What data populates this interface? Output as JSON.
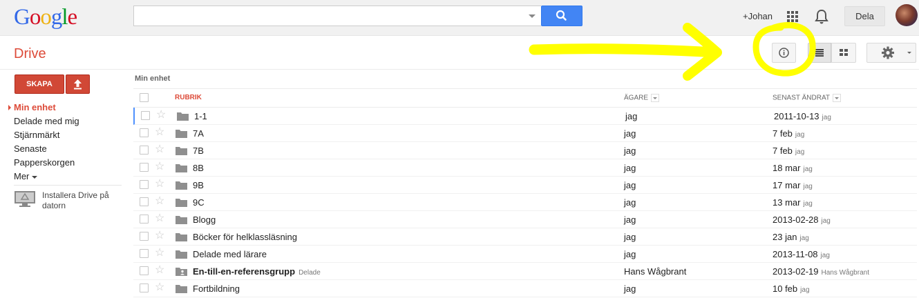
{
  "header": {
    "logo": "Google",
    "search_placeholder": "",
    "user_name": "+Johan",
    "share_label": "Dela"
  },
  "app": {
    "title": "Drive",
    "create_label": "SKAPA"
  },
  "sidebar": {
    "items": [
      {
        "label": "Min enhet",
        "active": true
      },
      {
        "label": "Delade med mig"
      },
      {
        "label": "Stjärnmärkt"
      },
      {
        "label": "Senaste"
      },
      {
        "label": "Papperskorgen"
      },
      {
        "label": "Mer"
      }
    ],
    "install_label": "Installera Drive på datorn"
  },
  "breadcrumb": "Min enhet",
  "table": {
    "columns": {
      "title": "RUBRIK",
      "owner": "ÄGARE",
      "modified": "SENAST ÄNDRAT"
    },
    "rows": [
      {
        "name": "1-1",
        "owner": "jag",
        "date": "2011-10-13",
        "by": "jag"
      },
      {
        "name": "7A",
        "owner": "jag",
        "date": "7 feb",
        "by": "jag"
      },
      {
        "name": "7B",
        "owner": "jag",
        "date": "7 feb",
        "by": "jag"
      },
      {
        "name": "8B",
        "owner": "jag",
        "date": "18 mar",
        "by": "jag"
      },
      {
        "name": "9B",
        "owner": "jag",
        "date": "17 mar",
        "by": "jag"
      },
      {
        "name": "9C",
        "owner": "jag",
        "date": "13 mar",
        "by": "jag"
      },
      {
        "name": "Blogg",
        "owner": "jag",
        "date": "2013-02-28",
        "by": "jag"
      },
      {
        "name": "Böcker för helklassläsning",
        "owner": "jag",
        "date": "23 jan",
        "by": "jag"
      },
      {
        "name": "Delade med lärare",
        "owner": "jag",
        "date": "2013-11-08",
        "by": "jag"
      },
      {
        "name": "En-till-en-referensgrupp",
        "owner": "Hans Wågbrant",
        "date": "2013-02-19",
        "by": "Hans Wågbrant",
        "shared_tag": "Delade",
        "bold": true,
        "shared_folder": true
      },
      {
        "name": "Fortbildning",
        "owner": "jag",
        "date": "10 feb",
        "by": "jag"
      }
    ]
  },
  "colors": {
    "accent_red": "#dd4b39",
    "search_blue": "#4285f4",
    "annotation_yellow": "#ffff00"
  },
  "icons": {
    "search_button": "search-icon",
    "apps": "apps-grid-icon",
    "notifications": "bell-icon",
    "upload": "upload-icon",
    "details": "info-icon",
    "list_view": "list-view-icon",
    "grid_view": "grid-view-icon",
    "settings": "gear-icon",
    "folder": "folder-icon",
    "star": "star-icon",
    "monitor": "monitor-drive-icon"
  }
}
